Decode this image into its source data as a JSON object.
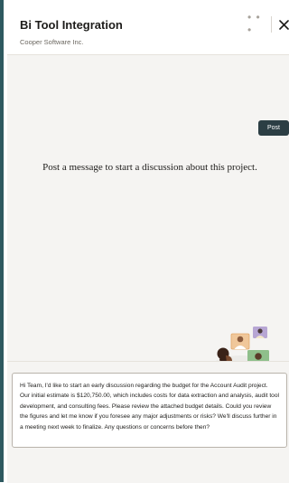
{
  "header": {
    "title": "Bi Tool Integration",
    "subtitle": "Cooper Software Inc.",
    "more_icon": "more-horizontal-icon",
    "more_glyph": "• • •",
    "close_icon": "close-icon"
  },
  "main": {
    "empty_message": "Post a message to start a discussion about this project.",
    "illustration": "video-conference-illustration"
  },
  "composer": {
    "message": "Hi Team, I'd like to start an early discussion regarding the budget for the Account Audit project. Our initial estimate is $120,750.00, which includes costs for data extraction and analysis, audit tool development, and consulting fees. Please review the attached budget details. Could you review the figures and let me know if you foresee any major adjustments or risks? We'll discuss further in a meeting next week to finalize. Any questions or concerns before then?",
    "post_label": "Post"
  },
  "colors": {
    "accent_border": "#2e5960",
    "post_button": "#2c3e44",
    "panel_background": "#f5f4f2"
  }
}
